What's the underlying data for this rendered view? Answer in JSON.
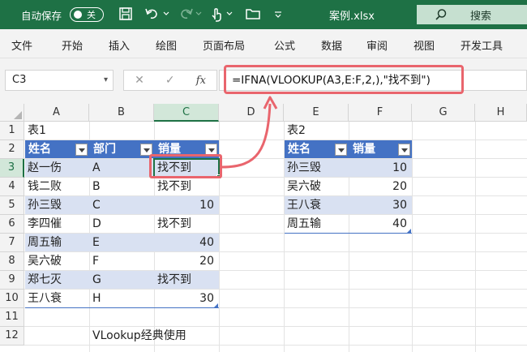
{
  "titlebar": {
    "autosave_label": "自动保存",
    "toggle_state": "关",
    "filename": "案例.xlsx",
    "search_label": "搜索"
  },
  "ribbon": {
    "tabs": [
      "文件",
      "开始",
      "插入",
      "绘图",
      "页面布局",
      "公式",
      "数据",
      "审阅",
      "视图",
      "开发工具"
    ]
  },
  "formula_bar": {
    "name_box": "C3",
    "cancel_icon": "close-icon",
    "enter_icon": "check-icon",
    "fx_label": "fx",
    "formula": "=IFNA(VLOOKUP(A3,E:F,2,),\"找不到\")"
  },
  "sheet": {
    "columns": [
      "A",
      "B",
      "C",
      "D",
      "E",
      "F",
      "G",
      "H"
    ],
    "rows": [
      "1",
      "2",
      "3",
      "4",
      "5",
      "6",
      "7",
      "8",
      "9",
      "10",
      "11",
      "12"
    ],
    "active_cell": "C3",
    "table1": {
      "title": "表1",
      "headers": [
        "姓名",
        "部门",
        "销量"
      ],
      "rows": [
        [
          "赵一伤",
          "A",
          "找不到"
        ],
        [
          "钱二败",
          "B",
          "找不到"
        ],
        [
          "孙三毁",
          "C",
          "10"
        ],
        [
          "李四催",
          "D",
          "找不到"
        ],
        [
          "周五输",
          "E",
          "40"
        ],
        [
          "吴六破",
          "F",
          "20"
        ],
        [
          "郑七灭",
          "G",
          "找不到"
        ],
        [
          "王八衰",
          "H",
          "30"
        ]
      ]
    },
    "table2": {
      "title": "表2",
      "headers": [
        "姓名",
        "销量"
      ],
      "rows": [
        [
          "孙三毁",
          "10"
        ],
        [
          "吴六破",
          "20"
        ],
        [
          "王八衰",
          "30"
        ],
        [
          "周五输",
          "40"
        ]
      ]
    },
    "caption": "VLookup经典使用"
  },
  "colors": {
    "excel_green": "#1e7145",
    "table_header": "#4472c4",
    "table_band": "#d9e1f2",
    "annotation": "#e9656d"
  }
}
